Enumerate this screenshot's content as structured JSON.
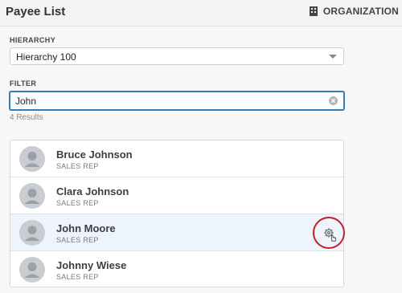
{
  "header": {
    "title": "Payee List",
    "org_label": "ORGANIZATION",
    "org_icon": "building-icon"
  },
  "hierarchy": {
    "label": "HIERARCHY",
    "selected": "Hierarchy 100"
  },
  "filter": {
    "label": "FILTER",
    "value": "John",
    "results": "4 Results"
  },
  "payees": [
    {
      "name": "Bruce Johnson",
      "role": "SALES REP"
    },
    {
      "name": "Clara Johnson",
      "role": "SALES REP"
    },
    {
      "name": "John Moore",
      "role": "SALES REP",
      "hovered": true,
      "row_action_icon": "gear-icon"
    },
    {
      "name": "Johnny Wiese",
      "role": "SALES REP"
    }
  ],
  "colors": {
    "focus_border": "#2f7ebc",
    "highlight_circle": "#c0202a",
    "hover_row": "#eef4fb"
  }
}
